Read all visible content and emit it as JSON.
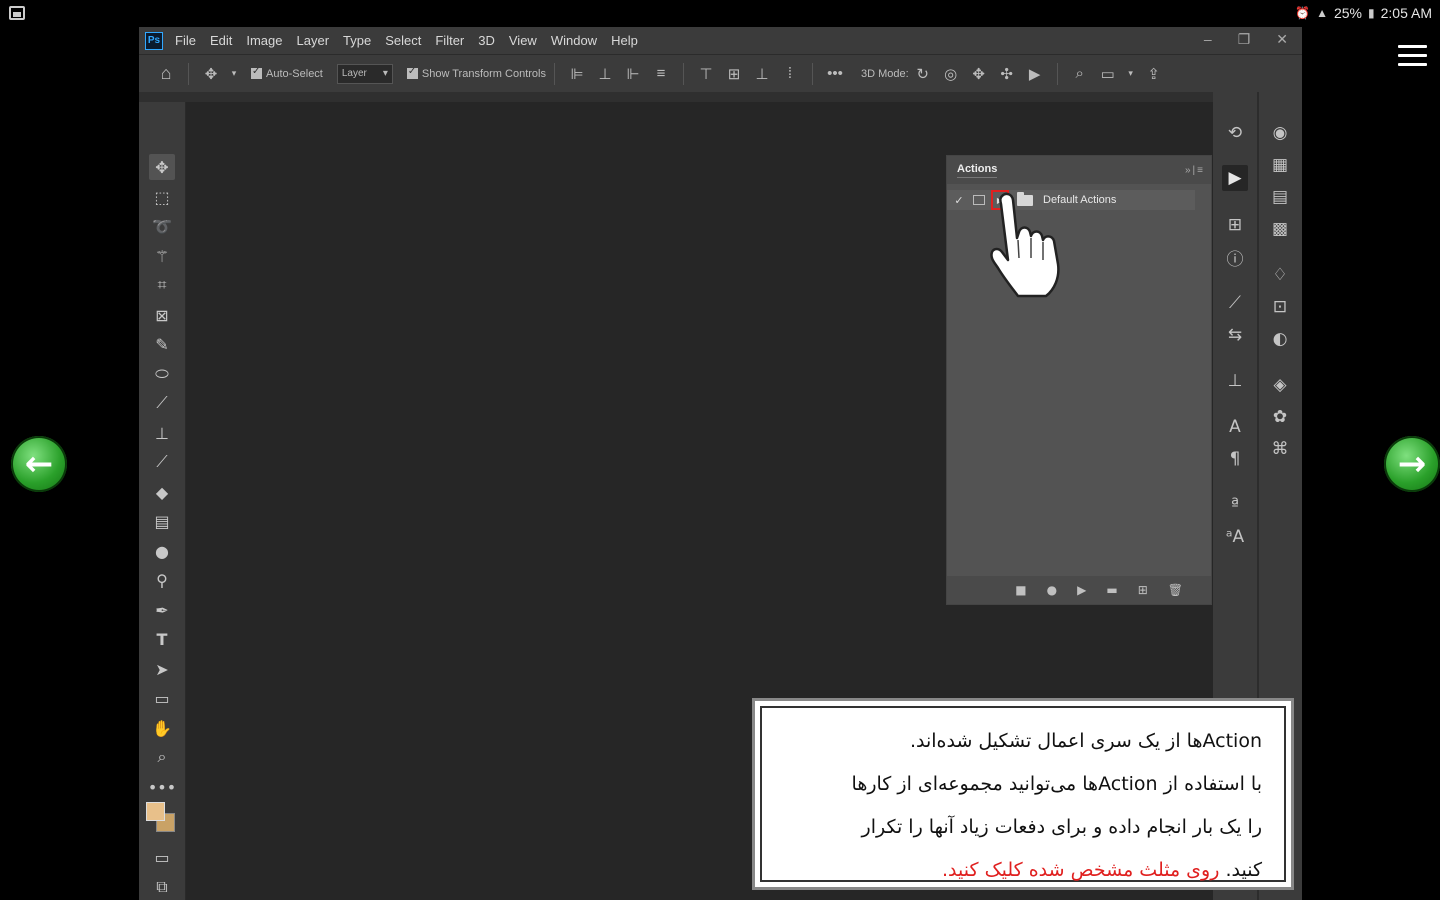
{
  "statusbar": {
    "battery": "25%",
    "time": "2:05 AM"
  },
  "photoshop": {
    "logo": "Ps",
    "menu": [
      "File",
      "Edit",
      "Image",
      "Layer",
      "Type",
      "Select",
      "Filter",
      "3D",
      "View",
      "Window",
      "Help"
    ],
    "options": {
      "auto_select_label": "Auto-Select",
      "layer_dropdown": "Layer",
      "show_transform_label": "Show Transform Controls",
      "mode_3d_label": "3D Mode:"
    },
    "actions_panel": {
      "tab_title": "Actions",
      "set_name": "Default Actions"
    }
  },
  "caption": {
    "line1": "Actionها از یک سری اعمال تشکیل شده‌اند.",
    "line2": "با استفاده از Actionها می‌توانید مجموعه‌ای از کارها",
    "line3": "را یک بار انجام داده و برای دفعات زیاد آنها را تکرار",
    "line4_black": "کنید.",
    "line4_red": "روی مثلث مشخص شده کلیک کنید."
  },
  "colors": {
    "accent_red": "#e0201f",
    "nav_green": "#2aa02a",
    "foreground_swatch": "#e8c08a",
    "background_swatch": "#c9a266"
  },
  "icons": {
    "nav_back": "arrow-left-icon",
    "nav_next": "arrow-right-icon",
    "menu": "hamburger-menu-icon"
  }
}
